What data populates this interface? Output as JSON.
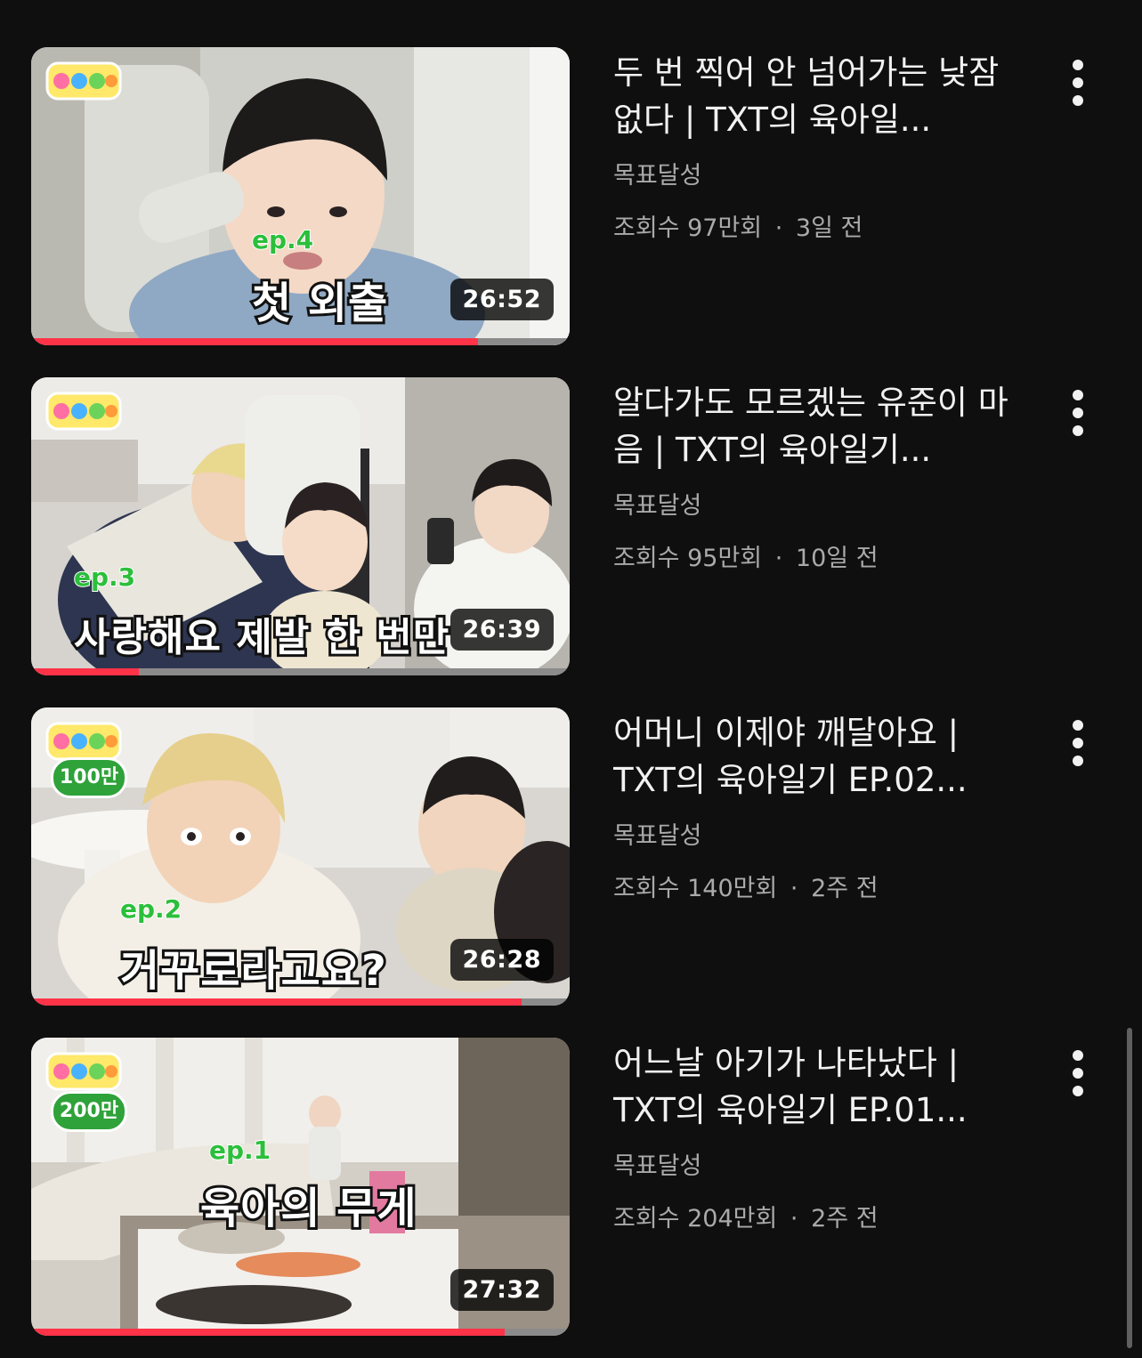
{
  "videos": [
    {
      "title": "두 번 찍어 안 넘어가는 낮잠 없다 | TXT의 육아일...",
      "channel": "목표달성",
      "views": "조회수 97만회",
      "age": "3일 전",
      "duration": "26:52",
      "thumb_ep": "ep.4",
      "thumb_caption": "첫 외출",
      "thumb_badge": "",
      "watched_fraction": 0.83
    },
    {
      "title": "알다가도 모르겠는 유준이 마음 | TXT의 육아일기...",
      "channel": "목표달성",
      "views": "조회수 95만회",
      "age": "10일 전",
      "duration": "26:39",
      "thumb_ep": "ep.3",
      "thumb_caption": "사랑해요 제발 한 번만",
      "thumb_badge": "",
      "watched_fraction": 0.2
    },
    {
      "title": "어머니 이제야 깨달아요 | TXT의 육아일기 EP.02...",
      "channel": "목표달성",
      "views": "조회수 140만회",
      "age": "2주 전",
      "duration": "26:28",
      "thumb_ep": "ep.2",
      "thumb_caption": "거꾸로라고요?",
      "thumb_badge": "100만",
      "watched_fraction": 0.91
    },
    {
      "title": "어느날 아기가 나타났다 | TXT의 육아일기 EP.01...",
      "channel": "목표달성",
      "views": "조회수 204만회",
      "age": "2주 전",
      "duration": "27:32",
      "thumb_ep": "ep.1",
      "thumb_caption": "육아의 무게",
      "thumb_badge": "200만",
      "watched_fraction": 0.88
    }
  ],
  "colors": {
    "background": "#0f0f0f",
    "progress": "#ff3348",
    "secondary_text": "#aaaaaa",
    "badge": "#2fa23a"
  },
  "icons": {
    "more": "vertical-ellipsis-icon",
    "logo": "show-logo-icon"
  },
  "separator": "·"
}
